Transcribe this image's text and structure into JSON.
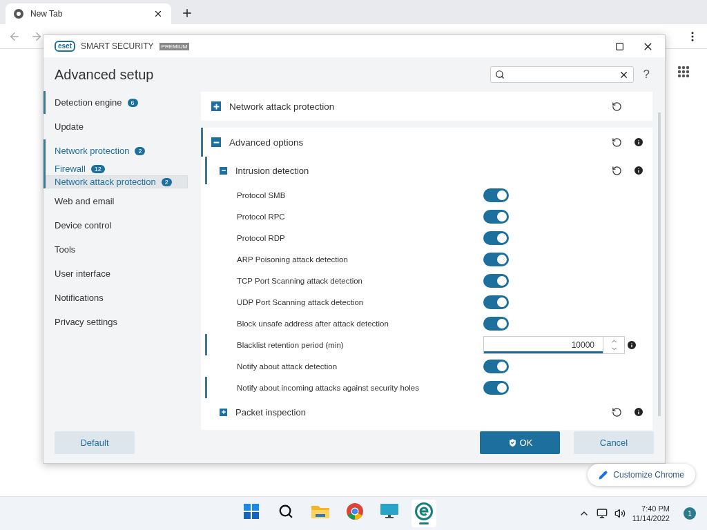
{
  "browser": {
    "tab": {
      "title": "New Tab"
    }
  },
  "dialog": {
    "logo": "eset",
    "product": "SMART SECURITY",
    "edition": "PREMIUM",
    "title": "Advanced setup",
    "help": "?"
  },
  "sidebar": {
    "items": [
      {
        "label": "Detection engine",
        "badge": "6",
        "changed": true,
        "selected": false
      },
      {
        "label": "Update",
        "changed": false,
        "selected": false
      },
      {
        "label": "Network protection",
        "badge": "2",
        "changed": true,
        "selected": false,
        "expanded": true,
        "children": [
          {
            "label": "Firewall",
            "badge": "12",
            "selected": false
          },
          {
            "label": "Network attack protection",
            "badge": "2",
            "selected": true
          }
        ]
      },
      {
        "label": "Web and email",
        "changed": false,
        "selected": false
      },
      {
        "label": "Device control",
        "changed": false,
        "selected": false
      },
      {
        "label": "Tools",
        "changed": false,
        "selected": false
      },
      {
        "label": "User interface",
        "changed": false,
        "selected": false
      },
      {
        "label": "Notifications",
        "changed": false,
        "selected": false
      },
      {
        "label": "Privacy settings",
        "changed": false,
        "selected": false
      }
    ]
  },
  "sections": [
    {
      "title": "Network attack protection",
      "expanded": false,
      "changed": false,
      "info": false
    },
    {
      "title": "Advanced options",
      "expanded": true,
      "changed": true,
      "info": true,
      "children": [
        {
          "title": "Intrusion detection",
          "expanded": true,
          "changed": true,
          "info": true,
          "rows": [
            {
              "label": "Protocol SMB",
              "kind": "toggle",
              "on": true,
              "changed": false
            },
            {
              "label": "Protocol RPC",
              "kind": "toggle",
              "on": true,
              "changed": false
            },
            {
              "label": "Protocol RDP",
              "kind": "toggle",
              "on": true,
              "changed": false
            },
            {
              "label": "ARP Poisoning attack detection",
              "kind": "toggle",
              "on": true,
              "changed": false
            },
            {
              "label": "TCP Port Scanning attack detection",
              "kind": "toggle",
              "on": true,
              "changed": false
            },
            {
              "label": "UDP Port Scanning attack detection",
              "kind": "toggle",
              "on": true,
              "changed": false
            },
            {
              "label": "Block unsafe address after attack detection",
              "kind": "toggle",
              "on": true,
              "changed": false
            },
            {
              "label": "Blacklist retention period (min)",
              "kind": "number",
              "value": "10000",
              "changed": true,
              "info": true
            },
            {
              "label": "Notify about attack detection",
              "kind": "toggle",
              "on": true,
              "changed": false
            },
            {
              "label": "Notify about incoming attacks against security holes",
              "kind": "toggle",
              "on": true,
              "changed": true
            }
          ]
        },
        {
          "title": "Packet inspection",
          "expanded": false,
          "changed": false,
          "info": true
        }
      ]
    }
  ],
  "buttons": [
    {
      "label": "Default",
      "kind": "secondary"
    },
    {
      "label": "OK",
      "kind": "primary"
    },
    {
      "label": "Cancel",
      "kind": "secondary"
    }
  ],
  "customize": {
    "label": "Customize Chrome"
  },
  "taskbar": {
    "apps": [
      {
        "active": false
      },
      {
        "active": false
      },
      {
        "active": false
      },
      {
        "active": false
      },
      {
        "active": false
      },
      {
        "active": true
      }
    ],
    "time": "7:40 PM",
    "date": "11/14/2022",
    "notifications": "1"
  }
}
